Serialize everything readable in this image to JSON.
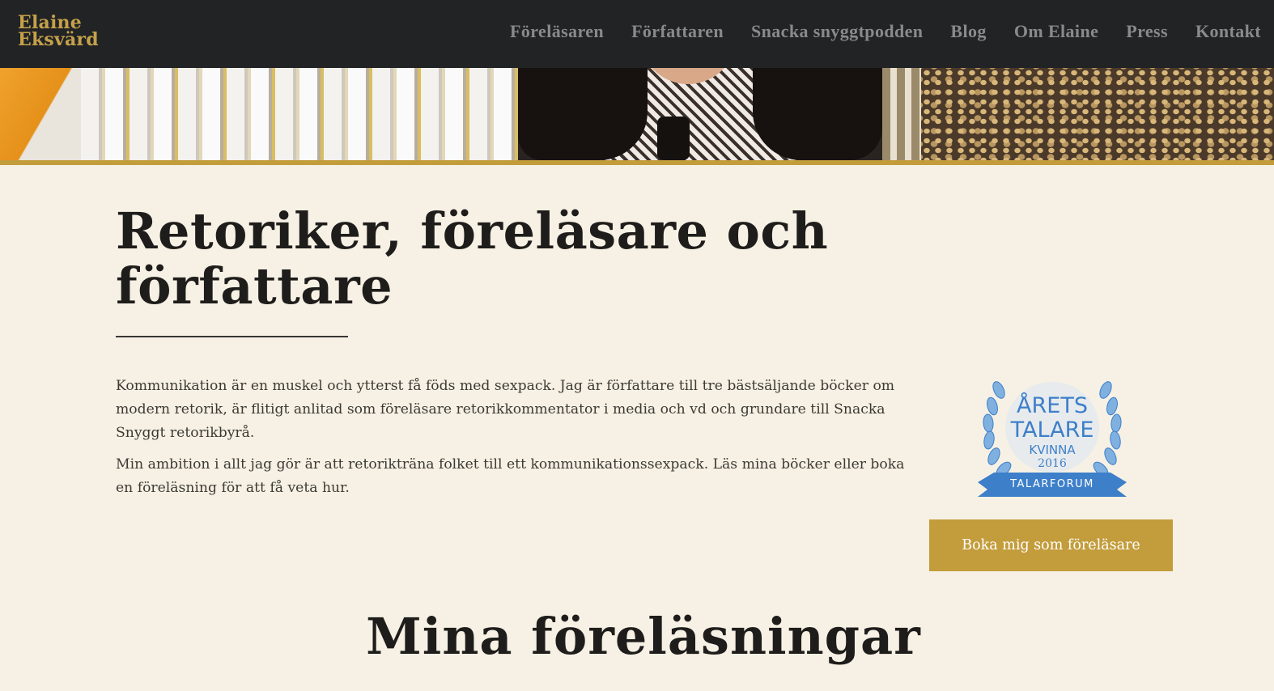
{
  "header": {
    "logo_line1": "Elaine",
    "logo_line2": "Eksvärd",
    "nav": [
      {
        "label": "Föreläsaren"
      },
      {
        "label": "Författaren"
      },
      {
        "label": "Snacka snyggtpodden"
      },
      {
        "label": "Blog"
      },
      {
        "label": "Om Elaine"
      },
      {
        "label": "Press"
      },
      {
        "label": "Kontakt"
      }
    ]
  },
  "main": {
    "title": "Retoriker, föreläsare och författare",
    "paragraphs": [
      "Kommunikation är en muskel och ytterst få föds med sexpack. Jag är författare till tre bästsäljande böcker om modern retorik, är flitigt anlitad som föreläsare retorikkommentator i media och vd och grundare till Snacka Snyggt retorikbyrå.",
      "Min ambition i allt jag gör är att retorikträna folket till ett kommunikationssexpack. Läs mina böcker eller boka en föreläsning för att få veta hur."
    ],
    "badge": {
      "line1": "ÅRETS",
      "line2": "TALARE",
      "line3": "KVINNA",
      "year": "2016",
      "ribbon": "TALARFORUM"
    },
    "cta_label": "Boka mig som föreläsare",
    "section_title": "Mina föreläsningar"
  },
  "colors": {
    "header_bg": "#222325",
    "accent_gold": "#c39c3b",
    "page_bg": "#f6f1e4",
    "badge_blue": "#3d7fc9"
  }
}
